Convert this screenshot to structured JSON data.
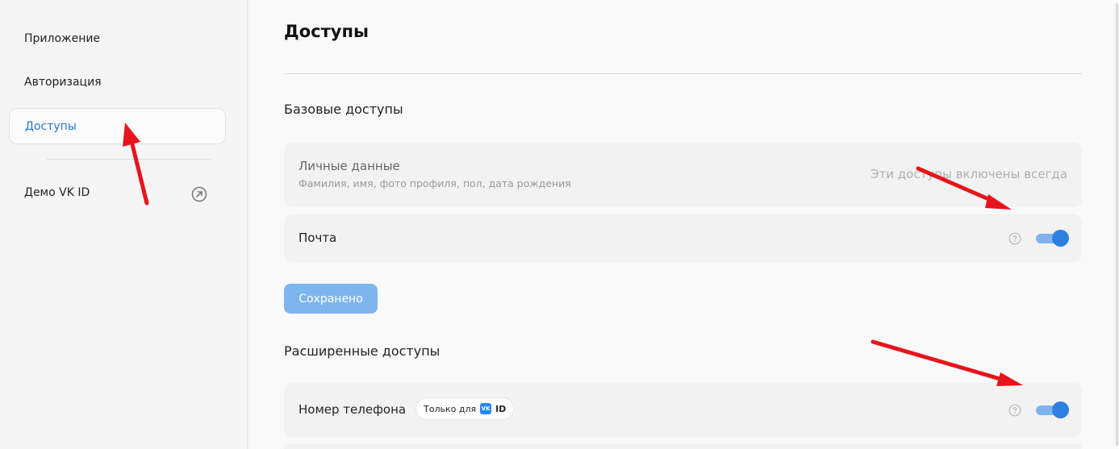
{
  "sidebar": {
    "items": [
      {
        "label": "Приложение"
      },
      {
        "label": "Авторизация"
      },
      {
        "label": "Доступы"
      }
    ],
    "demo_label": "Демо VK ID"
  },
  "page": {
    "title": "Доступы"
  },
  "basic": {
    "title": "Базовые доступы",
    "personal": {
      "label": "Личные данные",
      "sub": "Фамилия, имя, фото профиля, пол, дата рождения",
      "note": "Эти доступы включены всегда"
    },
    "mail": {
      "label": "Почта",
      "enabled": true
    },
    "save_label": "Сохранено"
  },
  "extended": {
    "title": "Расширенные доступы",
    "phone": {
      "label": "Номер телефона",
      "badge_text": "Только для",
      "badge_logo": "VK",
      "badge_id": "ID",
      "enabled": true
    }
  },
  "colors": {
    "accent": "#2f7fe0",
    "active_nav_text": "#2a74c9",
    "button_disabled": "#7db6ef",
    "annotation_arrow": "#e8141b"
  }
}
